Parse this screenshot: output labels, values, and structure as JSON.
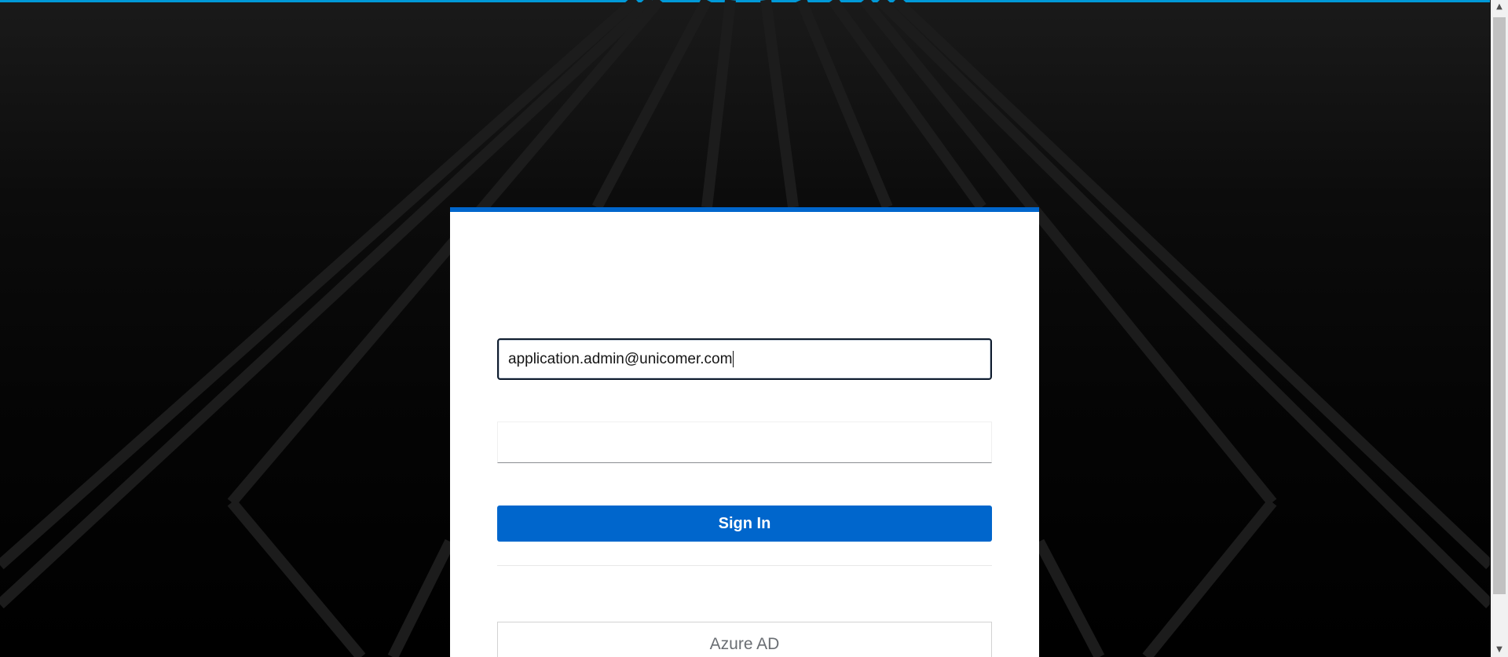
{
  "login": {
    "username_value": "application.admin@unicomer.com",
    "password_value": "",
    "signin_label": "Sign In",
    "providers": [
      {
        "label": "Azure AD"
      }
    ]
  },
  "colors": {
    "accent_top": "#0099d8",
    "primary": "#0066cc",
    "background": "#000000",
    "card": "#ffffff"
  },
  "icons": {
    "scroll_up": "scroll-up-arrow-icon",
    "scroll_down": "scroll-down-arrow-icon"
  }
}
